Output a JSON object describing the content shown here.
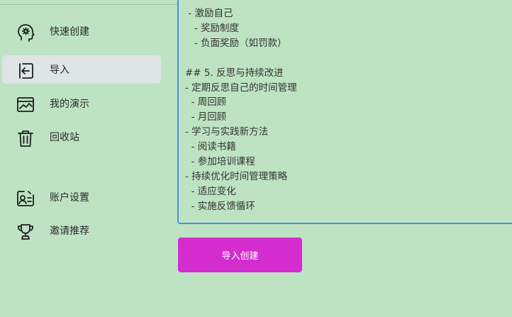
{
  "sidebar": {
    "items": [
      {
        "id": "quick-create",
        "label": "快速创建",
        "icon": "head-gear-icon",
        "active": false
      },
      {
        "id": "import",
        "label": "导入",
        "icon": "import-icon",
        "active": true
      },
      {
        "id": "my-presentations",
        "label": "我的演示",
        "icon": "presentation-icon",
        "active": false
      },
      {
        "id": "trash",
        "label": "回收站",
        "icon": "trash-icon",
        "active": false
      },
      {
        "id": "account-settings",
        "label": "账户设置",
        "icon": "account-card-icon",
        "active": false
      },
      {
        "id": "referral",
        "label": "邀请推荐",
        "icon": "trophy-icon",
        "active": false
      }
    ]
  },
  "editor": {
    "lines": [
      " - 激励自己",
      "   - 奖励制度",
      "   - 负面奖励（如罚款）",
      "",
      "## 5. 反思与持续改进",
      "- 定期反思自己的时间管理",
      "  - 周回顾",
      "  - 月回顾",
      "- 学习与实践新方法",
      "  - 阅读书籍",
      "  - 参加培训课程",
      "- 持续优化时间管理策略",
      "  - 适应变化",
      "  - 实施反馈循环"
    ]
  },
  "actions": {
    "import_button_label": "导入创建"
  },
  "colors": {
    "background": "#bde3c3",
    "accent": "#d42ccf",
    "active_item": "#dfe4e6",
    "editor_border": "#4a90d9"
  }
}
